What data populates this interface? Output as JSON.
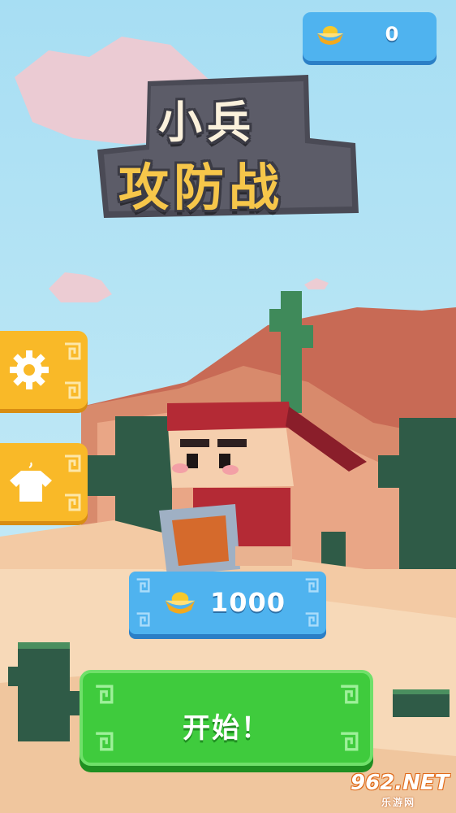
{
  "gold": {
    "value": "0"
  },
  "logo": {
    "line1": "小兵",
    "line2": "攻防战"
  },
  "cost": {
    "value": "1000"
  },
  "start": {
    "label": "开始！"
  },
  "watermark": {
    "main": "962.NET",
    "sub": "乐游网"
  },
  "colors": {
    "blue": "#4fb3ef",
    "yellow": "#f9b928",
    "green": "#3fcb3d",
    "sky": "#a9dff2"
  },
  "icons": [
    "gold-ingot-icon",
    "gear-icon",
    "shirt-icon"
  ]
}
